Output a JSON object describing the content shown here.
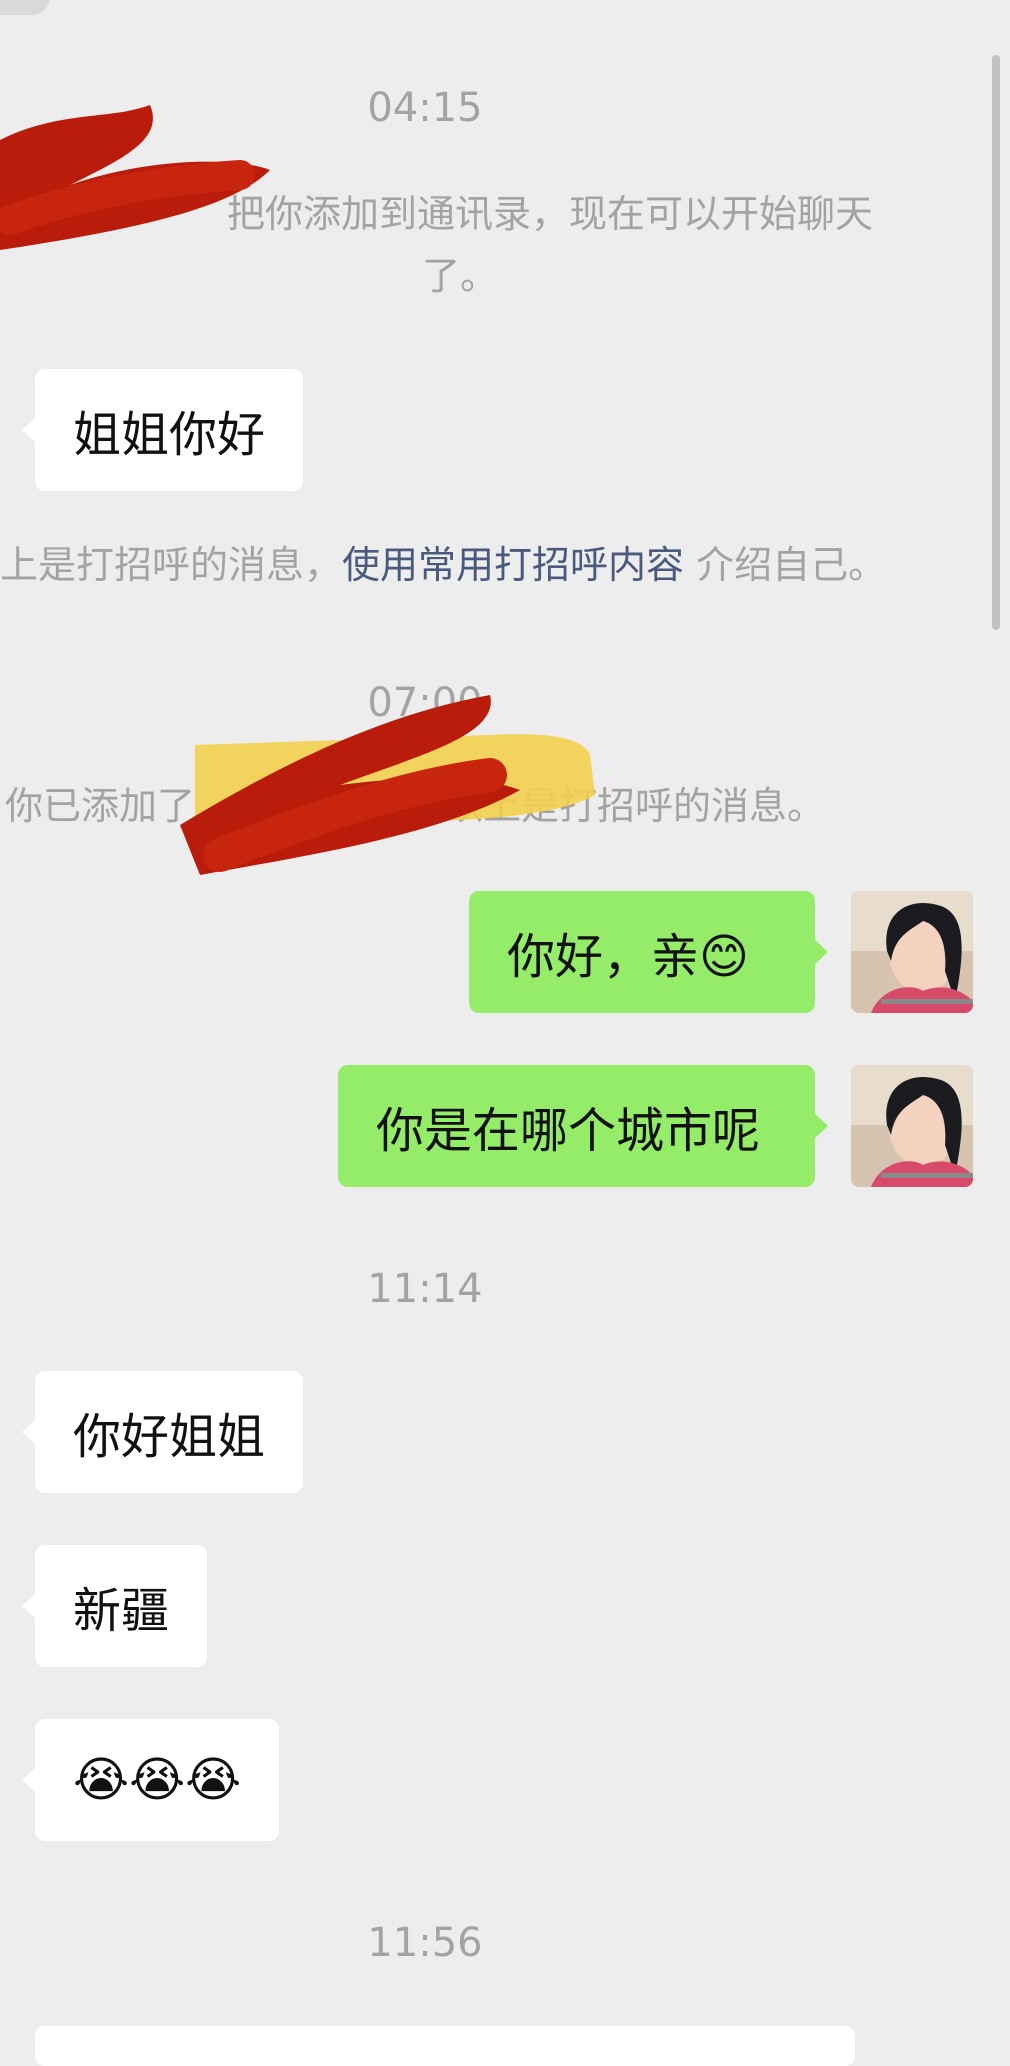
{
  "timestamps": {
    "t1": "04:15",
    "t2": "07:00",
    "t3": "11:14",
    "t4": "11:56"
  },
  "system_messages": {
    "added_line1": "你已添加了，现在可以开始聊天",
    "added_line1_visible": "把你添加到通讯录，现在可以开始聊天",
    "added_line2": "了。",
    "greeting_prefix": "上是打招呼的消息，",
    "greeting_link": "使用常用打招呼内容",
    "greeting_suffix": "介绍自己。",
    "added_prefix": "你已添加了",
    "added_suffix": "以上是打招呼的消息。"
  },
  "messages": [
    {
      "side": "left",
      "text": "姐姐你好"
    },
    {
      "side": "right",
      "text": "你好，亲😊"
    },
    {
      "side": "right",
      "text": "你是在哪个城市呢"
    },
    {
      "side": "left",
      "text": "你好姐姐"
    },
    {
      "side": "left",
      "text": "新疆"
    },
    {
      "side": "left",
      "text": "😭😭😭"
    }
  ],
  "colors": {
    "background": "#ededed",
    "incoming_bubble": "#ffffff",
    "outgoing_bubble": "#95ec69",
    "link": "#4a5a7e",
    "redaction": "#b91c0a"
  },
  "icons": {
    "avatar": "user-avatar-photo"
  }
}
